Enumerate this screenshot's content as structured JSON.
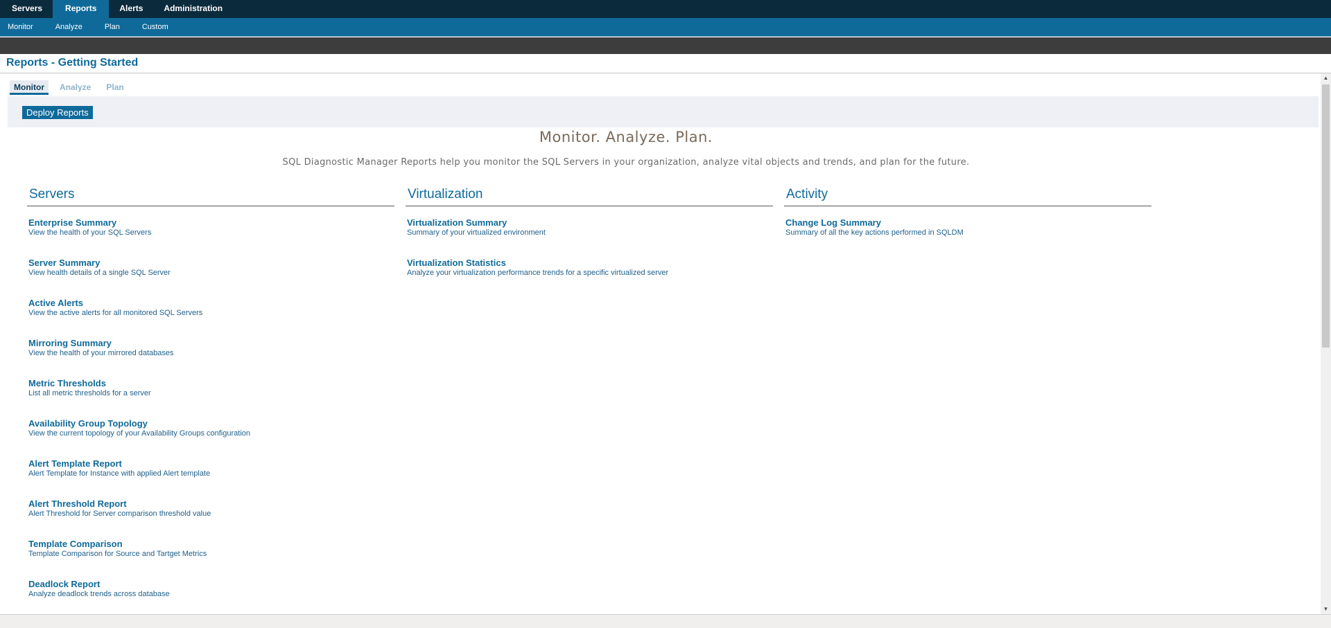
{
  "top_nav": {
    "tabs": [
      "Servers",
      "Reports",
      "Alerts",
      "Administration"
    ],
    "active": "Reports"
  },
  "sub_nav": {
    "items": [
      "Monitor",
      "Analyze",
      "Plan",
      "Custom"
    ]
  },
  "page": {
    "title": "Reports - Getting Started"
  },
  "report_tabs": {
    "items": [
      "Monitor",
      "Analyze",
      "Plan"
    ],
    "active": "Monitor"
  },
  "deploy_button_label": "Deploy Reports",
  "hero": {
    "title": "Monitor. Analyze. Plan.",
    "subtitle": "SQL Diagnostic Manager Reports help you monitor the SQL Servers in your organization, analyze vital objects and trends, and plan for the future."
  },
  "columns": {
    "servers": {
      "heading": "Servers",
      "reports": [
        {
          "name": "Enterprise Summary",
          "desc": "View the health of your SQL Servers"
        },
        {
          "name": "Server Summary",
          "desc": "View health details of a single SQL Server"
        },
        {
          "name": "Active Alerts",
          "desc": "View the active alerts for all monitored SQL Servers"
        },
        {
          "name": "Mirroring Summary",
          "desc": "View the health of your mirrored databases"
        },
        {
          "name": "Metric Thresholds",
          "desc": "List all metric thresholds for a server"
        },
        {
          "name": "Availability Group Topology",
          "desc": "View the current topology of your Availability Groups configuration"
        },
        {
          "name": "Alert Template Report",
          "desc": "Alert Template for Instance with applied Alert template"
        },
        {
          "name": "Alert Threshold Report",
          "desc": "Alert Threshold for Server comparison threshold value"
        },
        {
          "name": "Template Comparison",
          "desc": "Template Comparison for Source and Tartget Metrics"
        },
        {
          "name": "Deadlock Report",
          "desc": "Analyze deadlock trends across database"
        }
      ]
    },
    "virtualization": {
      "heading": "Virtualization",
      "reports": [
        {
          "name": "Virtualization Summary",
          "desc": "Summary of your virtualized environment"
        },
        {
          "name": "Virtualization Statistics",
          "desc": "Analyze your virtualization performance trends for a specific virtualized server"
        }
      ]
    },
    "activity": {
      "heading": "Activity",
      "reports": [
        {
          "name": "Change Log Summary",
          "desc": "Summary of all the key actions performed in SQLDM"
        }
      ]
    }
  },
  "colors": {
    "top_nav_bg": "#0b2b3d",
    "accent_blue": "#0f6a9a",
    "dark_bar": "#3d3d3d",
    "hero_text": "#7a6a5a"
  },
  "icons": {
    "scroll_up": "scroll-up-arrow-icon",
    "scroll_down": "scroll-down-arrow-icon"
  }
}
